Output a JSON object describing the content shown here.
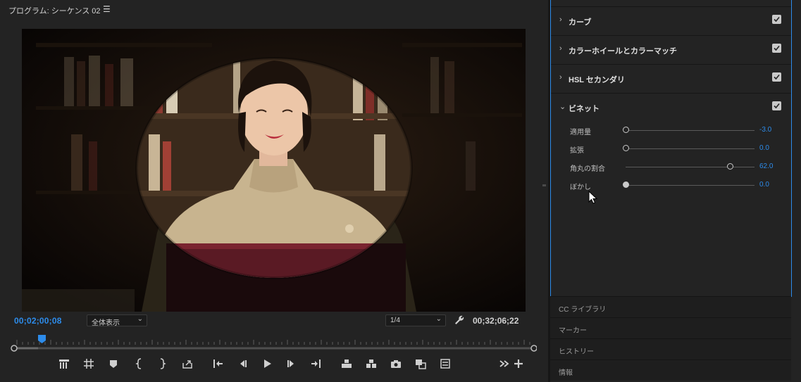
{
  "monitor": {
    "title": "プログラム: シーケンス 02",
    "menu_icon": "hamburger-icon",
    "current_time": "00;02;00;08",
    "zoom_value": "全体表示",
    "resolution_value": "1/4",
    "duration": "00;32;06;22",
    "accent": "#2d8ceb"
  },
  "transport": {
    "buttons": [
      {
        "name": "add-marker-button",
        "icon": "marker-list-icon"
      },
      {
        "name": "safe-margins-button",
        "icon": "grid-icon"
      },
      {
        "name": "marker-button",
        "icon": "marker-icon"
      },
      {
        "name": "mark-in-button",
        "icon": "mark-in-icon"
      },
      {
        "name": "mark-out-button",
        "icon": "mark-out-icon"
      },
      {
        "name": "export-button",
        "icon": "export-icon"
      },
      {
        "name": "go-to-in-button",
        "icon": "go-to-in-icon"
      },
      {
        "name": "step-back-button",
        "icon": "step-back-icon"
      },
      {
        "name": "play-button",
        "icon": "play-icon"
      },
      {
        "name": "step-forward-button",
        "icon": "step-forward-icon"
      },
      {
        "name": "go-to-out-button",
        "icon": "go-to-out-icon"
      },
      {
        "name": "lift-button",
        "icon": "lift-icon"
      },
      {
        "name": "extract-button",
        "icon": "extract-icon"
      },
      {
        "name": "export-frame-button",
        "icon": "camera-icon"
      },
      {
        "name": "comparison-view-button",
        "icon": "compare-icon"
      },
      {
        "name": "proxy-toggle-button",
        "icon": "proxy-icon"
      },
      {
        "name": "more-button",
        "icon": "double-chevron-icon"
      },
      {
        "name": "button-editor-button",
        "icon": "plus-icon"
      }
    ]
  },
  "lumetri": {
    "sections": [
      {
        "title": "カーブ",
        "expanded": false,
        "checked": true
      },
      {
        "title": "カラーホイールとカラーマッチ",
        "expanded": false,
        "checked": true
      },
      {
        "title": "HSL セカンダリ",
        "expanded": false,
        "checked": true
      },
      {
        "title": "ビネット",
        "expanded": true,
        "checked": true
      }
    ],
    "vignette": {
      "params": [
        {
          "label": "適用量",
          "value": "-3.0",
          "position": 0.0
        },
        {
          "label": "拡張",
          "value": "0.0",
          "position": 0.0
        },
        {
          "label": "角丸の割合",
          "value": "62.0",
          "position": 0.81
        },
        {
          "label": "ぼかし",
          "value": "0.0",
          "position": 0.0
        }
      ]
    }
  },
  "panels": [
    {
      "label": "CC ライブラリ"
    },
    {
      "label": "マーカー"
    },
    {
      "label": "ヒストリー"
    },
    {
      "label": "情報"
    }
  ]
}
